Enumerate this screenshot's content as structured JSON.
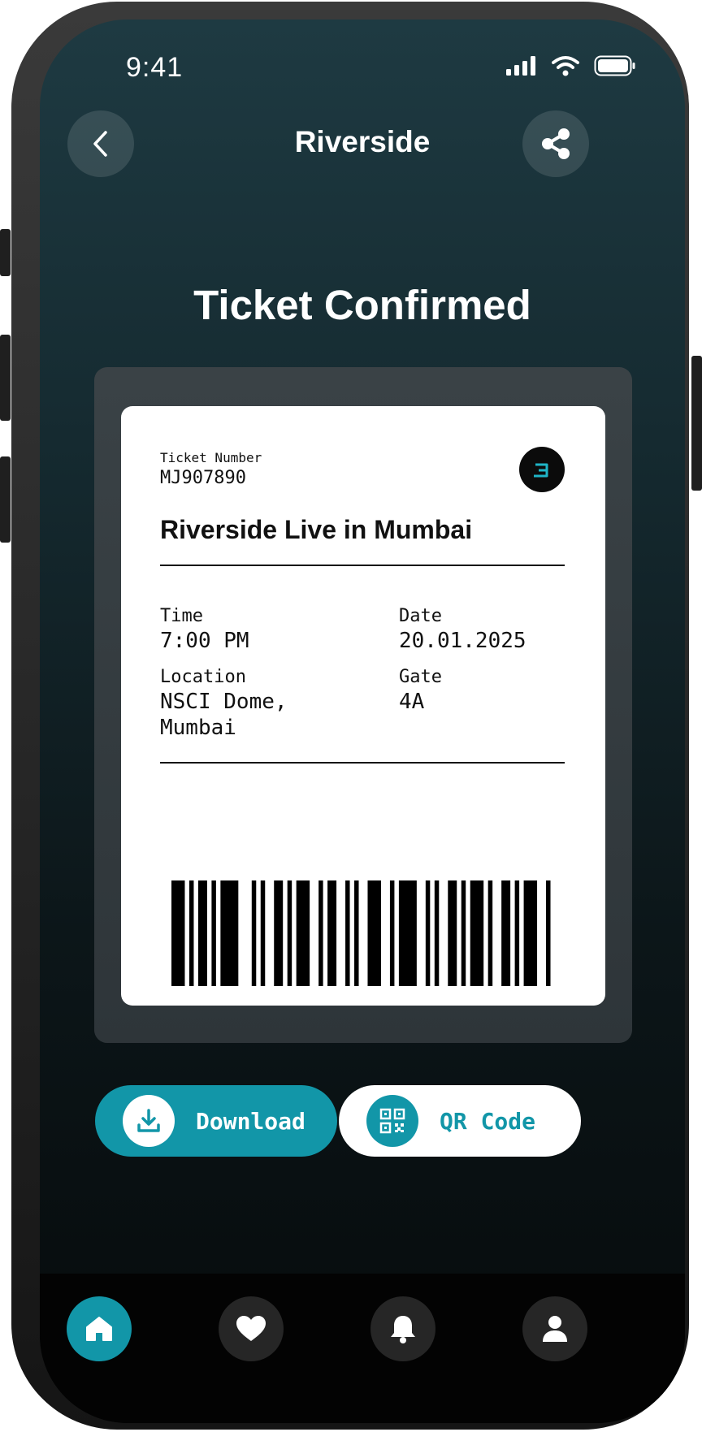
{
  "status_bar": {
    "time": "9:41"
  },
  "header": {
    "title": "Riverside"
  },
  "page": {
    "title": "Ticket Confirmed"
  },
  "ticket": {
    "number_label": "Ticket Number",
    "number": "MJ907890",
    "event": "Riverside Live in Mumbai",
    "time_label": "Time",
    "time": "7:00 PM",
    "date_label": "Date",
    "date": "20.01.2025",
    "location_label": "Location",
    "location_line1": "NSCI Dome,",
    "location_line2": "Mumbai",
    "gate_label": "Gate",
    "gate": "4A"
  },
  "actions": {
    "download_label": "Download",
    "qr_label": "QR Code"
  },
  "nav": {
    "items": [
      "home-icon",
      "heart-icon",
      "bell-icon",
      "user-icon"
    ],
    "active": "home-icon"
  },
  "colors": {
    "accent": "#1296a8",
    "card": "#ffffff",
    "background": "#152a30"
  }
}
